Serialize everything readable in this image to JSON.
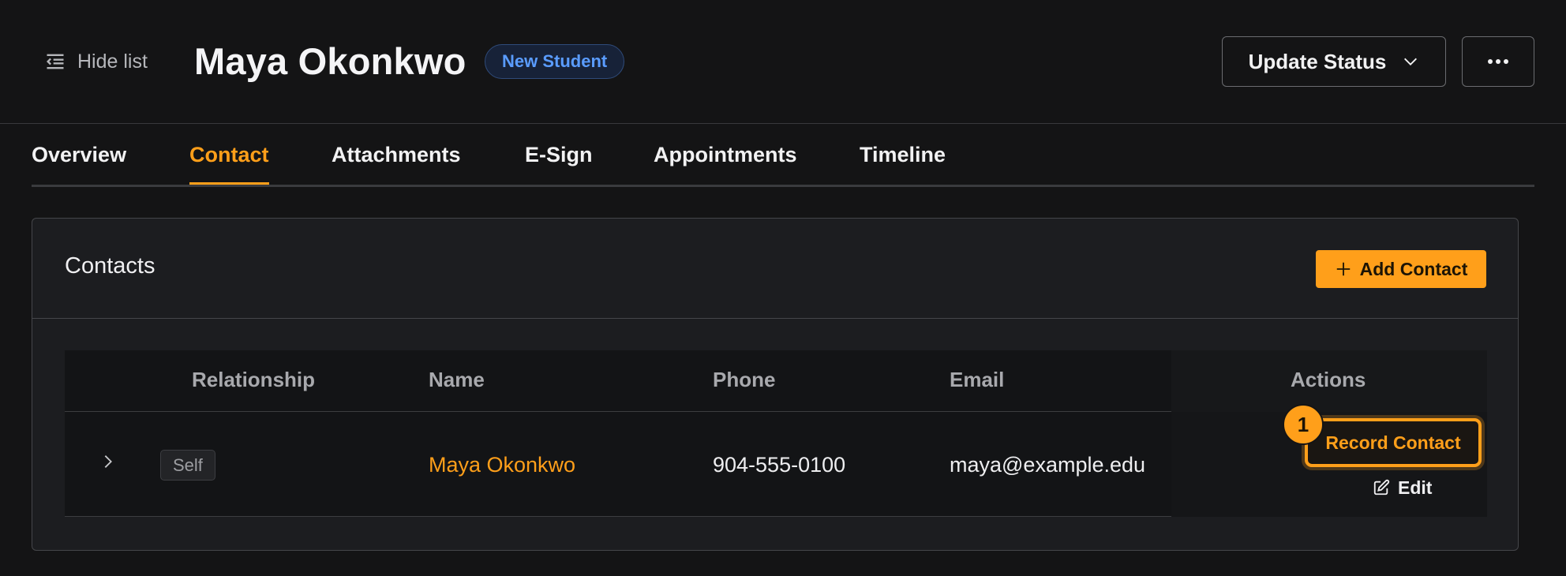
{
  "header": {
    "hide_list_label": "Hide list",
    "student_name": "Maya Okonkwo",
    "status_badge": "New Student",
    "update_status_label": "Update Status",
    "more_icon": "ellipsis-icon"
  },
  "tabs": [
    {
      "label": "Overview",
      "active": false
    },
    {
      "label": "Contact",
      "active": true
    },
    {
      "label": "Attachments",
      "active": false
    },
    {
      "label": "E-Sign",
      "active": false
    },
    {
      "label": "Appointments",
      "active": false
    },
    {
      "label": "Timeline",
      "active": false
    }
  ],
  "contacts_card": {
    "title": "Contacts",
    "add_button_label": "Add Contact",
    "columns": [
      "Relationship",
      "Name",
      "Phone",
      "Email",
      "Actions"
    ],
    "rows": [
      {
        "relationship": "Self",
        "name": "Maya Okonkwo",
        "phone": "904-555-0100",
        "email": "maya@example.edu",
        "primary_action": "Record Contact",
        "secondary_action": "Edit"
      }
    ],
    "step_badge": "1"
  },
  "colors": {
    "accent": "#ff9f1a",
    "badge_blue": "#5a9cff",
    "background": "#141415",
    "card": "#1c1d20"
  }
}
